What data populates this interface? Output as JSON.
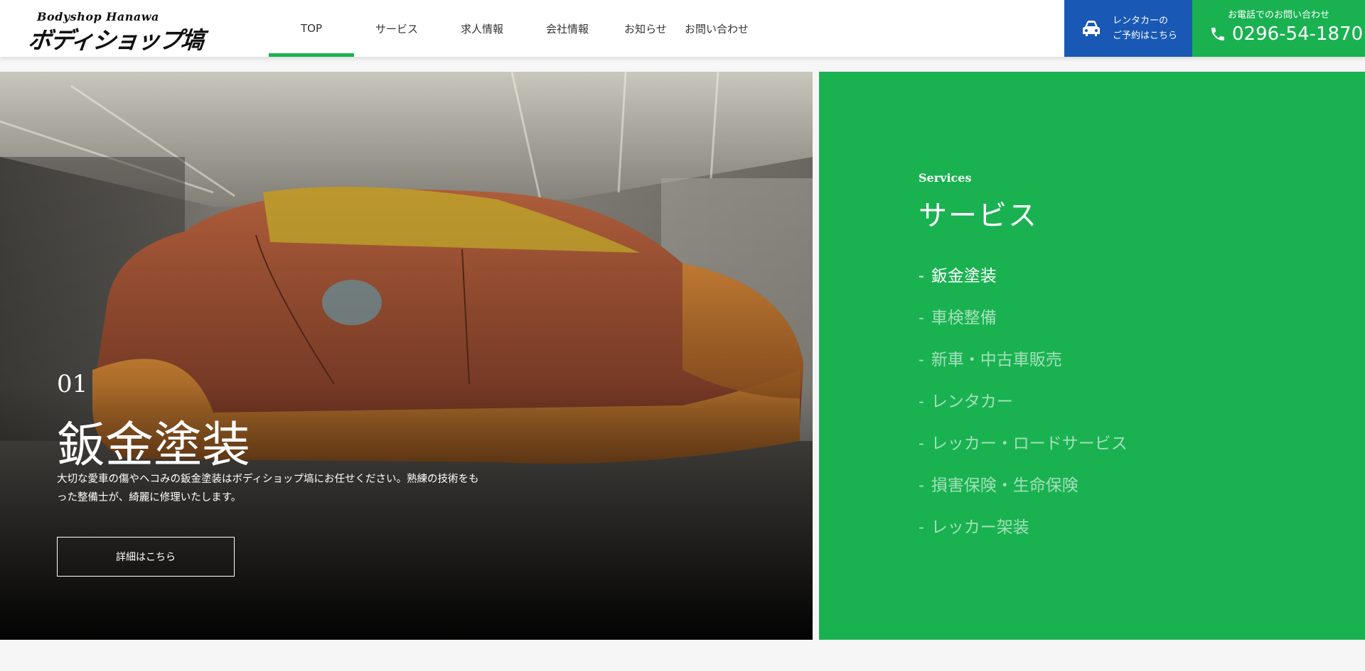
{
  "header": {
    "logo_sub": "Bodyshop Hanawa",
    "logo_main": "ボディショップ塙",
    "nav": [
      {
        "label": "TOP",
        "active": true
      },
      {
        "label": "サービス"
      },
      {
        "label": "求人情報"
      },
      {
        "label": "会社情報"
      },
      {
        "label": "お知らせ"
      },
      {
        "label": "お問い合わせ"
      }
    ],
    "rent": {
      "line1": "レンタカーの",
      "line2": "ご予約はこちら",
      "icon": "car-icon"
    },
    "phone": {
      "label": "お電話でのお問い合わせ",
      "number": "0296-54-1870",
      "icon": "phone-icon"
    }
  },
  "hero": {
    "number": "01",
    "title": "鈑金塗装",
    "description": "大切な愛車の傷やヘコみの鈑金塗装はボディショップ塙にお任せください。熟練の技術をもった整備士が、綺麗に修理いたします。",
    "button": "詳細はこちら"
  },
  "services": {
    "label_en": "Services",
    "label_ja": "サービス",
    "items": [
      {
        "label": "鈑金塗装",
        "active": true
      },
      {
        "label": "車検整備"
      },
      {
        "label": "新車・中古車販売"
      },
      {
        "label": "レンタカー"
      },
      {
        "label": "レッカー・ロードサービス"
      },
      {
        "label": "損害保険・生命保険"
      },
      {
        "label": "レッカー架装"
      }
    ],
    "dash": "-"
  },
  "colors": {
    "green": "#1ab251",
    "blue": "#1959b5"
  }
}
